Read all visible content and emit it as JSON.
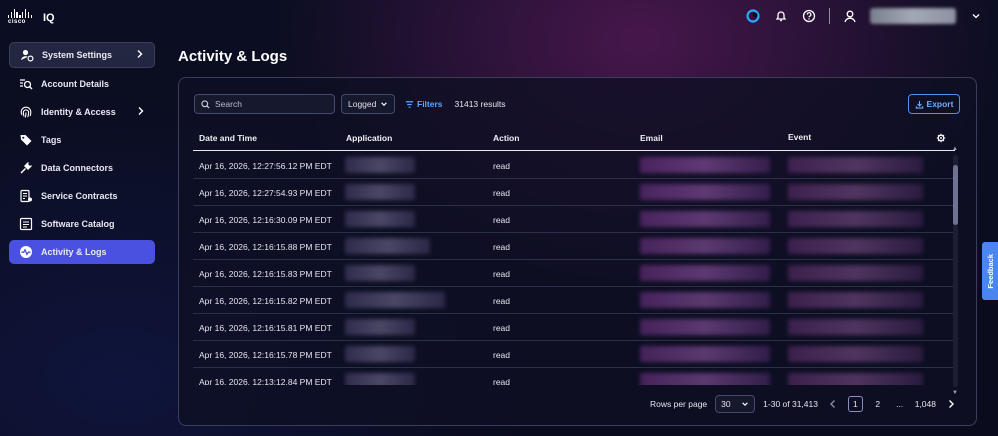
{
  "app": {
    "brand": "cisco",
    "name": "IQ"
  },
  "sidebar": {
    "items": [
      {
        "label": "System Settings",
        "icon": "user-gear-icon",
        "expandable": true
      },
      {
        "label": "Account Details",
        "icon": "magnifier-list-icon",
        "expandable": false
      },
      {
        "label": "Identity & Access",
        "icon": "fingerprint-icon",
        "expandable": true
      },
      {
        "label": "Tags",
        "icon": "tag-icon",
        "expandable": false
      },
      {
        "label": "Data Connectors",
        "icon": "plug-icon",
        "expandable": false
      },
      {
        "label": "Service Contracts",
        "icon": "contract-icon",
        "expandable": false
      },
      {
        "label": "Software Catalog",
        "icon": "catalog-icon",
        "expandable": false
      },
      {
        "label": "Activity & Logs",
        "icon": "activity-icon",
        "expandable": false,
        "active": true
      }
    ]
  },
  "page": {
    "title": "Activity & Logs"
  },
  "toolbar": {
    "search_placeholder": "Search",
    "filter_value": "Logged",
    "filters_label": "Filters",
    "results": "31413 results",
    "export_label": "Export"
  },
  "table": {
    "columns": [
      "Date and Time",
      "Application",
      "Action",
      "Email",
      "Event"
    ],
    "rows": [
      {
        "datetime": "Apr 16, 2026, 12:27:56.12 PM EDT",
        "action": "read"
      },
      {
        "datetime": "Apr 16, 2026, 12:27:54.93 PM EDT",
        "action": "read"
      },
      {
        "datetime": "Apr 16, 2026, 12:16:30.09 PM EDT",
        "action": "read"
      },
      {
        "datetime": "Apr 16, 2026, 12:16:15.88 PM EDT",
        "action": "read"
      },
      {
        "datetime": "Apr 16, 2026, 12:16:15.83 PM EDT",
        "action": "read"
      },
      {
        "datetime": "Apr 16, 2026, 12:16:15.82 PM EDT",
        "action": "read"
      },
      {
        "datetime": "Apr 16, 2026, 12:16:15.81 PM EDT",
        "action": "read"
      },
      {
        "datetime": "Apr 16, 2026, 12:16:15.78 PM EDT",
        "action": "read"
      },
      {
        "datetime": "Apr 16, 2026, 12:13:12.84 PM EDT",
        "action": "read"
      }
    ]
  },
  "pagination": {
    "rows_per_page_label": "Rows per page",
    "rows_per_page": "30",
    "range": "1-30 of 31,413",
    "pages": [
      "1",
      "2",
      "...",
      "1,048"
    ],
    "current_page": "1"
  },
  "feedback_label": "Feedback",
  "colors": {
    "accent": "#4a50e0",
    "link": "#5aa5ff",
    "feedback": "#4a86f0"
  }
}
